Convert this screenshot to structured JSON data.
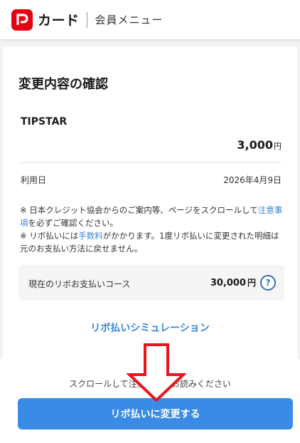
{
  "header": {
    "brand": "カード",
    "subtitle": "会員メニュー"
  },
  "confirm": {
    "title": "変更内容の確認",
    "merchant": "TIPSTAR",
    "amount": "3,000",
    "amount_unit": "円",
    "date_label": "利用日",
    "date_value": "2026年4月9日"
  },
  "notes": {
    "line1_prefix": "※ 日本クレジット協会からのご案内等、ページをスクロールして",
    "line1_link": "注意事項",
    "line1_suffix": "を必ずご確認ください。",
    "line2_prefix": "※ リボ払いには",
    "line2_link": "手数料",
    "line2_suffix": "がかかります。1度リボ払いに変更された明細は元のお支払い方法に戻せません。"
  },
  "course": {
    "label": "現在のリボお支払いコース",
    "value": "30,000",
    "unit": "円",
    "help": "?"
  },
  "simulation_link": "リボ払いシミュレーション",
  "footer": {
    "scroll_hint": "スクロールして注意事項をお読みください",
    "cta": "リボ払いに変更する"
  },
  "colors": {
    "brand_red": "#e60012",
    "link_blue": "#3a86d6",
    "cta_blue": "#3a8be6",
    "arrow_red": "#e5161e"
  }
}
